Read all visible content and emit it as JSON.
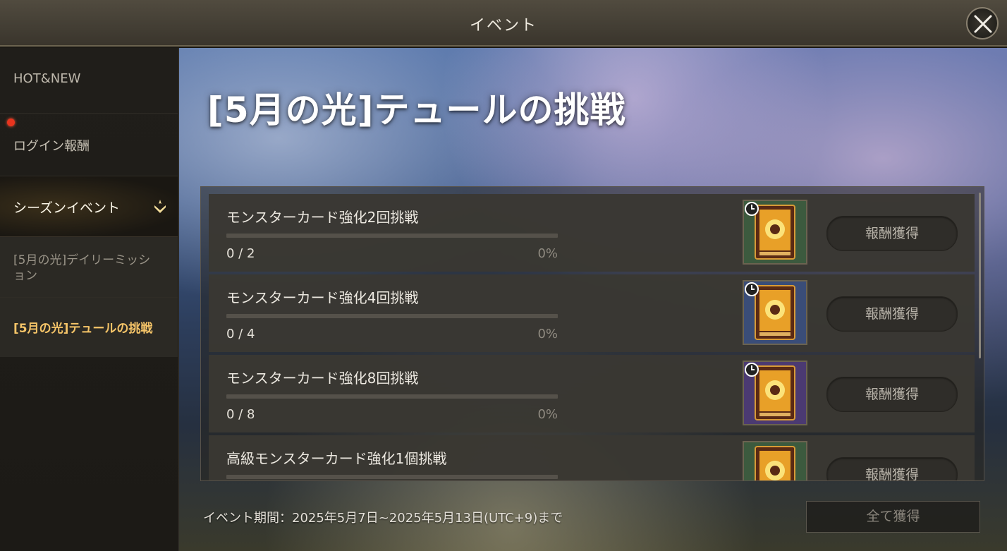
{
  "header": {
    "title": "イベント"
  },
  "sidebar": {
    "items": [
      {
        "label": "HOT&NEW"
      },
      {
        "label": "ログイン報酬",
        "has_notification": true
      },
      {
        "label": "シーズンイベント"
      },
      {
        "label": "[5月の光]デイリーミッション"
      },
      {
        "label": "[5月の光]テュールの挑戦",
        "selected": true
      }
    ]
  },
  "main": {
    "title": "[5月の光]テュールの挑戦",
    "missions": [
      {
        "title": "モンスターカード強化2回挑戦",
        "count": "0 / 2",
        "percent": "0%",
        "progress": 0,
        "reward_icon": "monster-card-green-icon",
        "claim_label": "報酬獲得"
      },
      {
        "title": "モンスターカード強化4回挑戦",
        "count": "0 / 4",
        "percent": "0%",
        "progress": 0,
        "reward_icon": "monster-card-blue-icon",
        "claim_label": "報酬獲得"
      },
      {
        "title": "モンスターカード強化8回挑戦",
        "count": "0 / 8",
        "percent": "0%",
        "progress": 0,
        "reward_icon": "monster-card-purple-icon",
        "claim_label": "報酬獲得"
      },
      {
        "title": "高級モンスターカード強化1個挑戦",
        "reward_icon": "monster-card-green-icon",
        "claim_label": "報酬獲得"
      }
    ],
    "period": "イベント期間：2025年5月7日~2025年5月13日(UTC+9)まで",
    "claim_all_label": "全て獲得"
  },
  "colors": {
    "selected_text": "#f5c468",
    "notification_dot": "#e8341e",
    "progress_track": "#55514a"
  }
}
